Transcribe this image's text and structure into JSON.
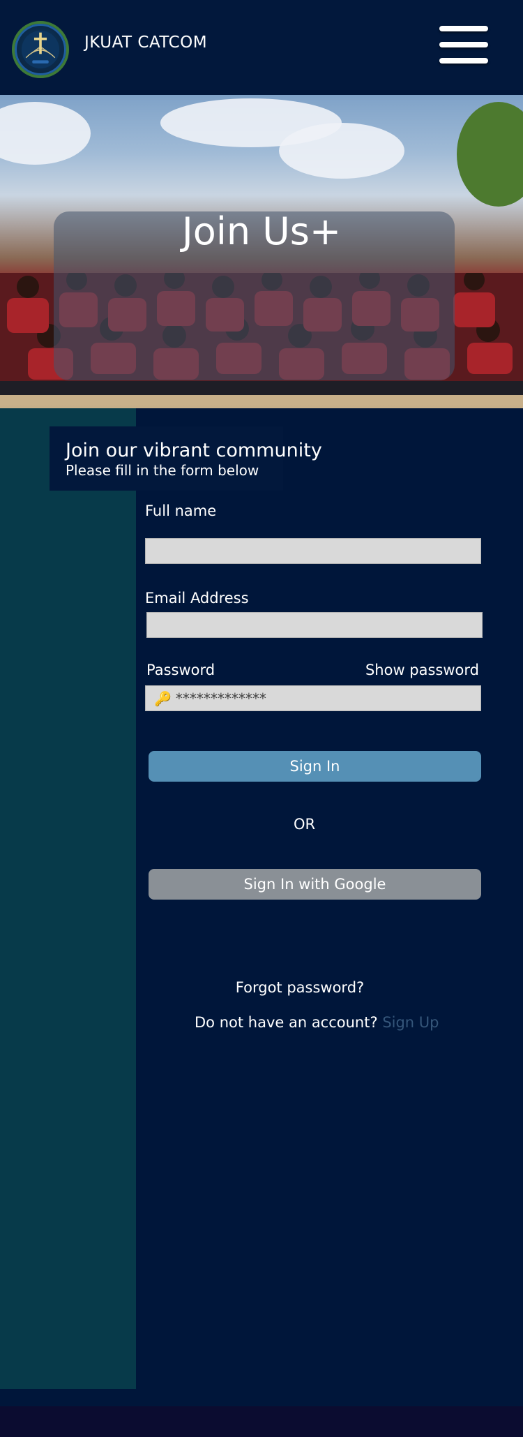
{
  "header": {
    "app_title": "JKUAT CATCOM",
    "logo_icon": "catcom-logo-icon",
    "menu_icon": "hamburger-menu-icon"
  },
  "hero": {
    "title": "Join Us+"
  },
  "intro": {
    "heading": "Join our vibrant community",
    "subheading": "Please fill in the form below"
  },
  "form": {
    "full_name_label": "Full name",
    "full_name_value": "",
    "email_label": "Email Address",
    "email_value": "",
    "password_label": "Password",
    "password_value": "*************",
    "password_icon": "key-icon",
    "show_password_label": "Show password",
    "sign_in_label": "Sign In",
    "or_text": "OR",
    "google_label": "Sign In with Google"
  },
  "links": {
    "forgot_password": "Forgot password?",
    "no_account": "Do not have an account?",
    "sign_up": "Sign Up"
  },
  "colors": {
    "background": "#00163a",
    "sidebar": "#073a4a",
    "sign_in_button": "#5590b5",
    "google_button": "#8a9096",
    "link": "#35567a"
  }
}
